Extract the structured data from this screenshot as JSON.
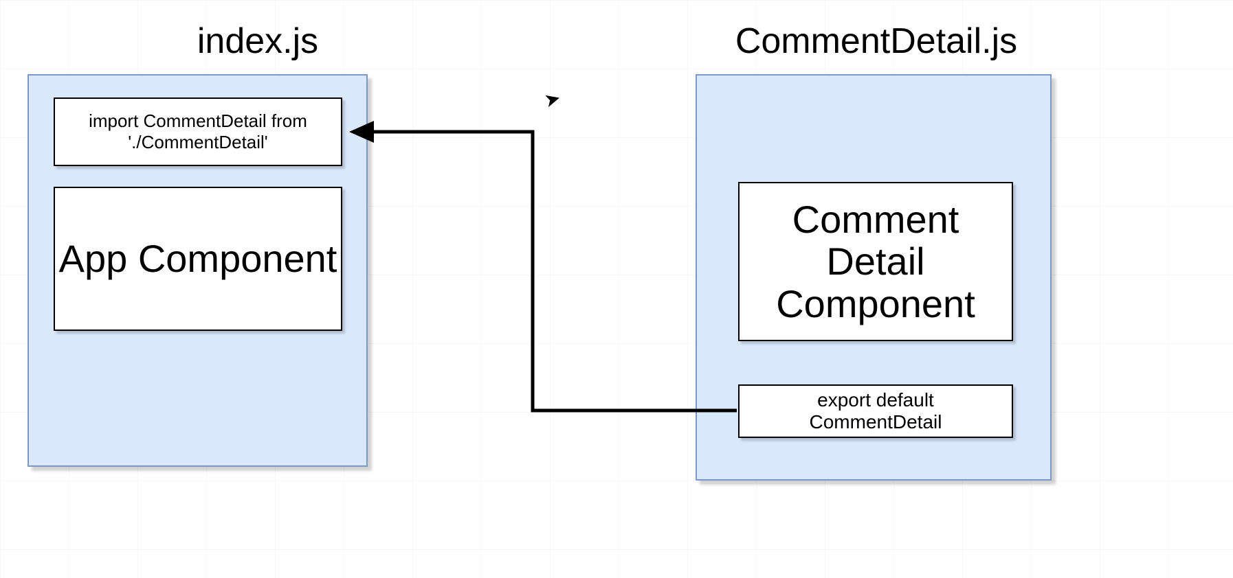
{
  "left_file": {
    "title": "index.js",
    "import_box": "import CommentDetail from './CommentDetail'",
    "component_box": "App Component"
  },
  "right_file": {
    "title": "CommentDetail.js",
    "component_box": "Comment Detail Component",
    "export_box": "export default CommentDetail"
  },
  "colors": {
    "container_fill": "#dae8fc",
    "container_border": "#7b98c6",
    "box_fill": "#ffffff",
    "box_border": "#000000",
    "arrow": "#000000"
  },
  "diagram": {
    "relation": "CommentDetail.js exports CommentDetail; index.js imports it",
    "arrow_from": "right_file.export_box",
    "arrow_to": "left_file.import_box"
  }
}
